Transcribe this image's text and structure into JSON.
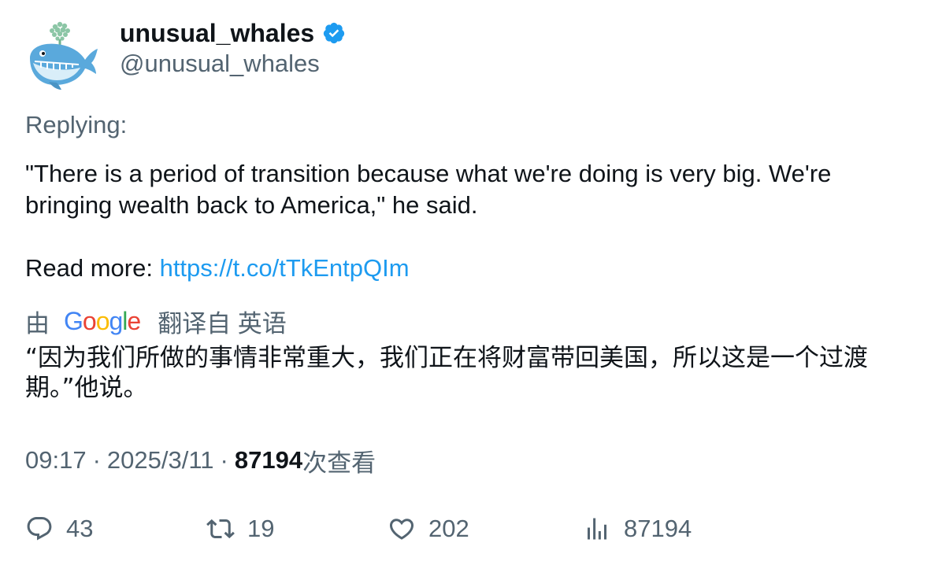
{
  "author": {
    "display_name": "unusual_whales",
    "handle": "@unusual_whales",
    "verified_icon": "verified-badge-icon",
    "avatar_icon": "whale-logo-icon"
  },
  "tweet": {
    "replying_label": "Replying:",
    "line1": "\"There is a period of transition because what we're doing is very big. We're bringing wealth back to America,\" he said.",
    "read_more_label": "Read more: ",
    "link": "https://t.co/tTkEntpQIm"
  },
  "translation": {
    "by_label": "由",
    "provider": "Google",
    "from_label": "翻译自 英语",
    "text": "“因为我们所做的事情非常重大，我们正在将财富带回美国，所以这是一个过渡期。”他说。"
  },
  "meta": {
    "time": "09:17",
    "separator": "·",
    "date": "2025/3/11",
    "views_count": "87194",
    "views_label": "次查看"
  },
  "actions": {
    "reply_count": "43",
    "retweet_count": "19",
    "like_count": "202",
    "views_count": "87194"
  },
  "colors": {
    "text_primary": "#0f1419",
    "text_secondary": "#536471",
    "link": "#1d9bf0",
    "verified": "#1d9bf0"
  }
}
